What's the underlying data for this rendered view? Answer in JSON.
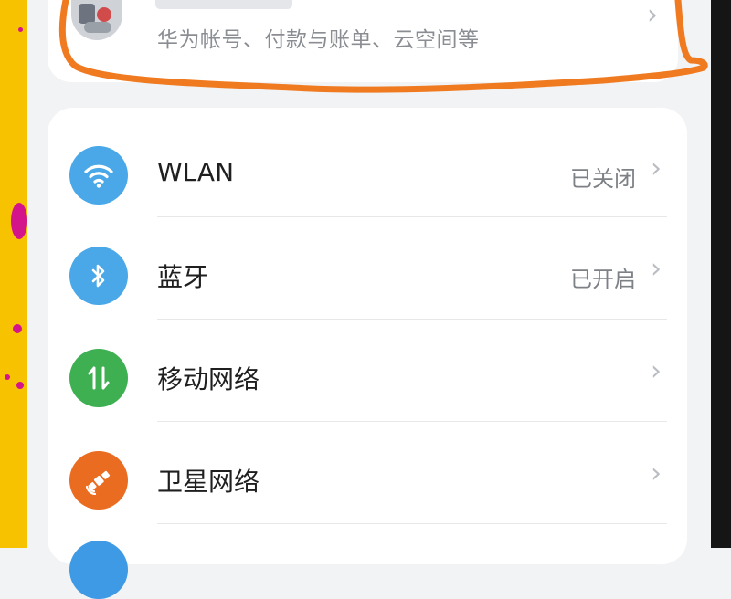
{
  "account": {
    "subtitle": "华为帐号、付款与账单、云空间等",
    "chevron": "›"
  },
  "settings": {
    "items": [
      {
        "label": "WLAN",
        "status": "已关闭",
        "icon": "wifi-icon",
        "color": "#4aa8e8"
      },
      {
        "label": "蓝牙",
        "status": "已开启",
        "icon": "bluetooth-icon",
        "color": "#4aa8e8"
      },
      {
        "label": "移动网络",
        "status": "",
        "icon": "mobile-data-icon",
        "color": "#3fb052"
      },
      {
        "label": "卫星网络",
        "status": "",
        "icon": "satellite-icon",
        "color": "#ea6c21"
      }
    ],
    "chevron": "›"
  },
  "colors": {
    "highlight": "#f07a20",
    "left_strip": "#f7c200",
    "right_strip": "#151515"
  }
}
